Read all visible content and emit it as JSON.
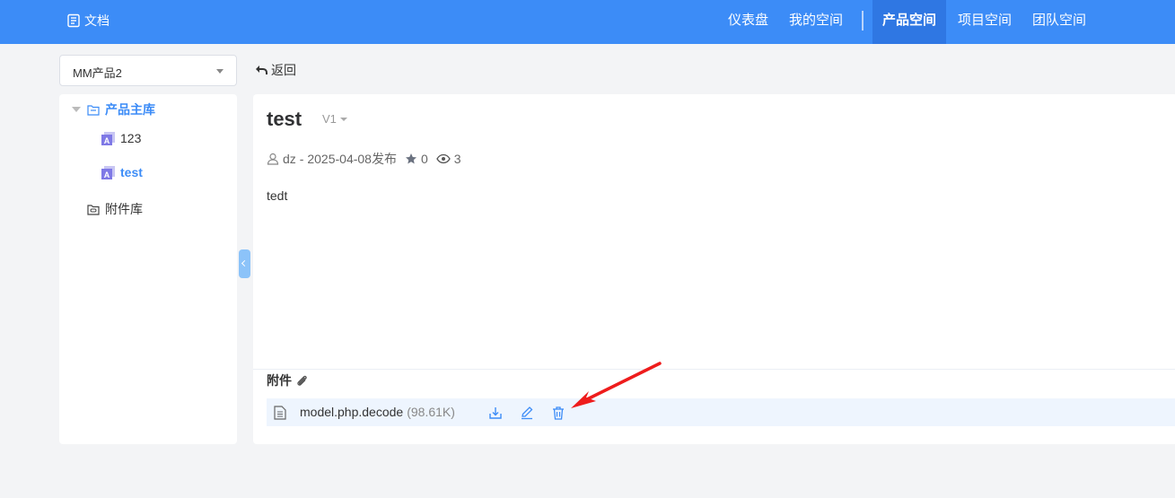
{
  "header": {
    "brand_label": "文档",
    "nav": [
      "仪表盘",
      "我的空间",
      "产品空间",
      "项目空间",
      "团队空间"
    ],
    "active_nav": "产品空间"
  },
  "toolbar": {
    "space_select_value": "MM产品2",
    "back_label": "返回"
  },
  "tree": {
    "root_label": "产品主库",
    "docs": [
      {
        "label": "123",
        "active": false
      },
      {
        "label": "test",
        "active": true
      }
    ],
    "attachment_lib_label": "附件库"
  },
  "document": {
    "title": "test",
    "version": "V1",
    "author": "dz",
    "published": "- 2025-04-08发布",
    "stars": "0",
    "views": "3",
    "body": "tedt"
  },
  "attachments": {
    "title": "附件",
    "files": [
      {
        "name": "model.php.decode",
        "size": "(98.61K)"
      }
    ]
  },
  "colors": {
    "primary": "#3c8cf7",
    "nav_active_bg": "#2f77e3",
    "attachment_row_bg": "#eef5fe"
  }
}
